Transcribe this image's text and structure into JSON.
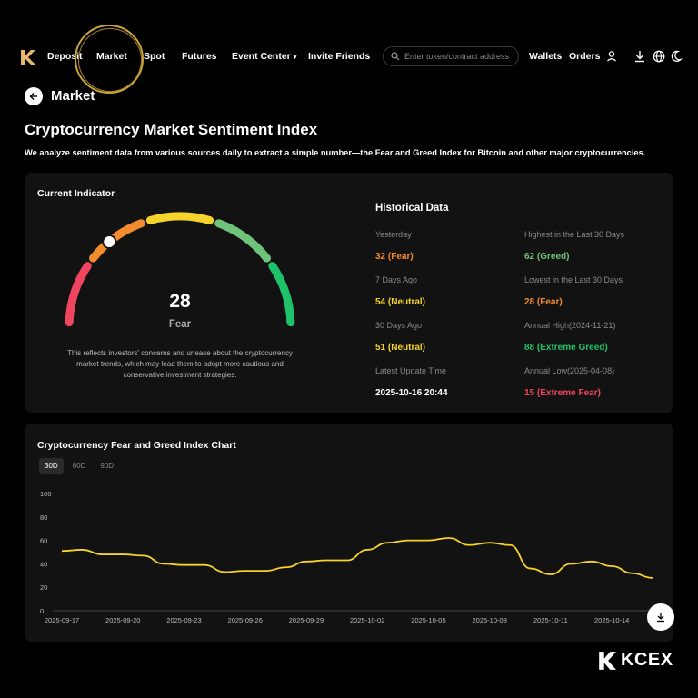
{
  "nav": {
    "items": [
      "Deposit",
      "Market",
      "Spot",
      "Futures",
      "Event Center",
      "Invite Friends"
    ],
    "search_placeholder": "Enter token/contract address",
    "wallets": "Wallets",
    "orders": "Orders"
  },
  "header": {
    "crumb": "Market",
    "title": "Cryptocurrency Market Sentiment Index",
    "description": "We analyze sentiment data from various sources daily to extract a simple number—the Fear and Greed Index for Bitcoin and other major cryptocurrencies."
  },
  "indicator": {
    "title": "Current Indicator",
    "value": "28",
    "label": "Fear",
    "description": "This reflects investors' concerns and unease about the cryptocurrency market trends, which may lead them to adopt more cautious and conservative investment strategies.",
    "gauge_level": 0.28,
    "segment_colors": [
      "#f0455e",
      "#f28a2e",
      "#f5d22c",
      "#6fc27a",
      "#1fc16b"
    ]
  },
  "historical": {
    "title": "Historical Data",
    "rows": [
      {
        "label": "Yesterday",
        "value": "32 (Fear)",
        "color": "#f28a2e"
      },
      {
        "label": "7 Days Ago",
        "value": "54 (Neutral)",
        "color": "#f5d22c"
      },
      {
        "label": "30 Days Ago",
        "value": "51 (Neutral)",
        "color": "#f5d22c"
      },
      {
        "label": "Latest Update Time",
        "value": "2025-10-16 20:44",
        "color": "#ffffff"
      }
    ],
    "rows_right": [
      {
        "label": "Highest in the Last 30 Days",
        "value": "62 (Greed)",
        "color": "#6fc27a"
      },
      {
        "label": "Lowest in the Last 30 Days",
        "value": "28 (Fear)",
        "color": "#f28a2e"
      },
      {
        "label": "Annual High(2024-11-21)",
        "value": "88 (Extreme Greed)",
        "color": "#1fc16b"
      },
      {
        "label": "Annual Low(2025-04-08)",
        "value": "15 (Extreme Fear)",
        "color": "#f0455e"
      }
    ]
  },
  "chart_section": {
    "title": "Cryptocurrency Fear and Greed Index Chart",
    "tabs": [
      "30D",
      "60D",
      "90D"
    ],
    "active_tab": "30D"
  },
  "chart_data": {
    "type": "line",
    "ylim": [
      0,
      100
    ],
    "y_ticks": [
      "0",
      "20",
      "40",
      "60",
      "80",
      "100"
    ],
    "x_ticks": [
      "2025-09-17",
      "2025-09-20",
      "2025-09-23",
      "2025-09-26",
      "2025-09-29",
      "2025-10-02",
      "2025-10-05",
      "2025-10-08",
      "2025-10-11",
      "2025-10-14"
    ],
    "x": [
      "2025-09-17",
      "2025-09-18",
      "2025-09-19",
      "2025-09-20",
      "2025-09-21",
      "2025-09-22",
      "2025-09-23",
      "2025-09-24",
      "2025-09-25",
      "2025-09-26",
      "2025-09-27",
      "2025-09-28",
      "2025-09-29",
      "2025-09-30",
      "2025-10-01",
      "2025-10-02",
      "2025-10-03",
      "2025-10-04",
      "2025-10-05",
      "2025-10-06",
      "2025-10-07",
      "2025-10-08",
      "2025-10-09",
      "2025-10-10",
      "2025-10-11",
      "2025-10-12",
      "2025-10-13",
      "2025-10-14",
      "2025-10-15",
      "2025-10-16"
    ],
    "series": [
      {
        "values": [
          51,
          52,
          48,
          48,
          47,
          40,
          39,
          39,
          33,
          34,
          34,
          37,
          42,
          43,
          43,
          52,
          58,
          60,
          60,
          62,
          56,
          58,
          56,
          36,
          31,
          40,
          42,
          38,
          32,
          28
        ],
        "color": "#f5d22c"
      }
    ],
    "grid": false
  },
  "brand": {
    "name": "KCEX"
  }
}
